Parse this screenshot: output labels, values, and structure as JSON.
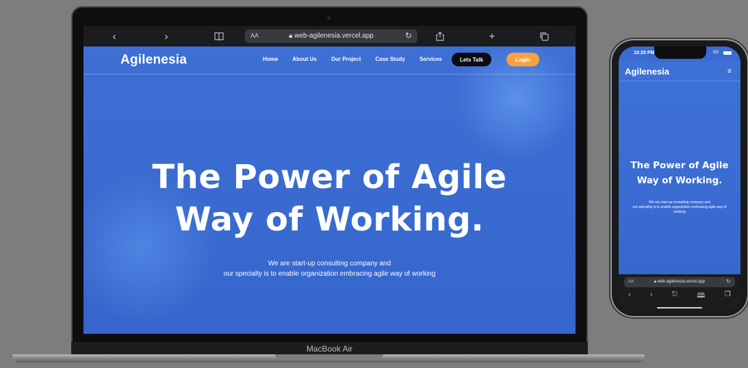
{
  "device_label": "MacBook Air",
  "browser": {
    "back_icon": "chevron-left-icon",
    "forward_icon": "chevron-right-icon",
    "bookmarks_icon": "book-icon",
    "reader_label": "AA",
    "url": "web-agilenesia.vercel.app",
    "reload_icon": "reload-icon",
    "share_icon": "share-icon",
    "new_tab_icon": "plus-icon",
    "tabs_icon": "tabs-icon"
  },
  "site": {
    "brand": "Agilenesia",
    "nav": [
      "Home",
      "About Us",
      "Our Project",
      "Case Study",
      "Services"
    ],
    "lets_talk": "Lets Talk",
    "login": "Login",
    "hero_title_line1": "The Power of Agile",
    "hero_title_line2": "Way of Working.",
    "hero_sub_line1": "We are start-up consulting company and",
    "hero_sub_line2": "our specialty is to enable organization embracing agile way of working",
    "colors": {
      "background": "#3a6ad0",
      "lets_talk_bg": "#0b0b12",
      "login_bg": "#f7a23c"
    }
  },
  "phone": {
    "time": "10:25 PM",
    "signal": "5G",
    "brand": "Agilenesia",
    "menu_icon": "menu-icon",
    "hero_title_line1": "The Power of Agile",
    "hero_title_line2": "Way of Working.",
    "hero_sub_line1": "We are start-up consulting company and",
    "hero_sub_line2": "our speciality is to enable organization embracing agile way of",
    "hero_sub_line3": "working",
    "reader_label": "AA",
    "url": "web-agilenesia.vercel.app"
  }
}
